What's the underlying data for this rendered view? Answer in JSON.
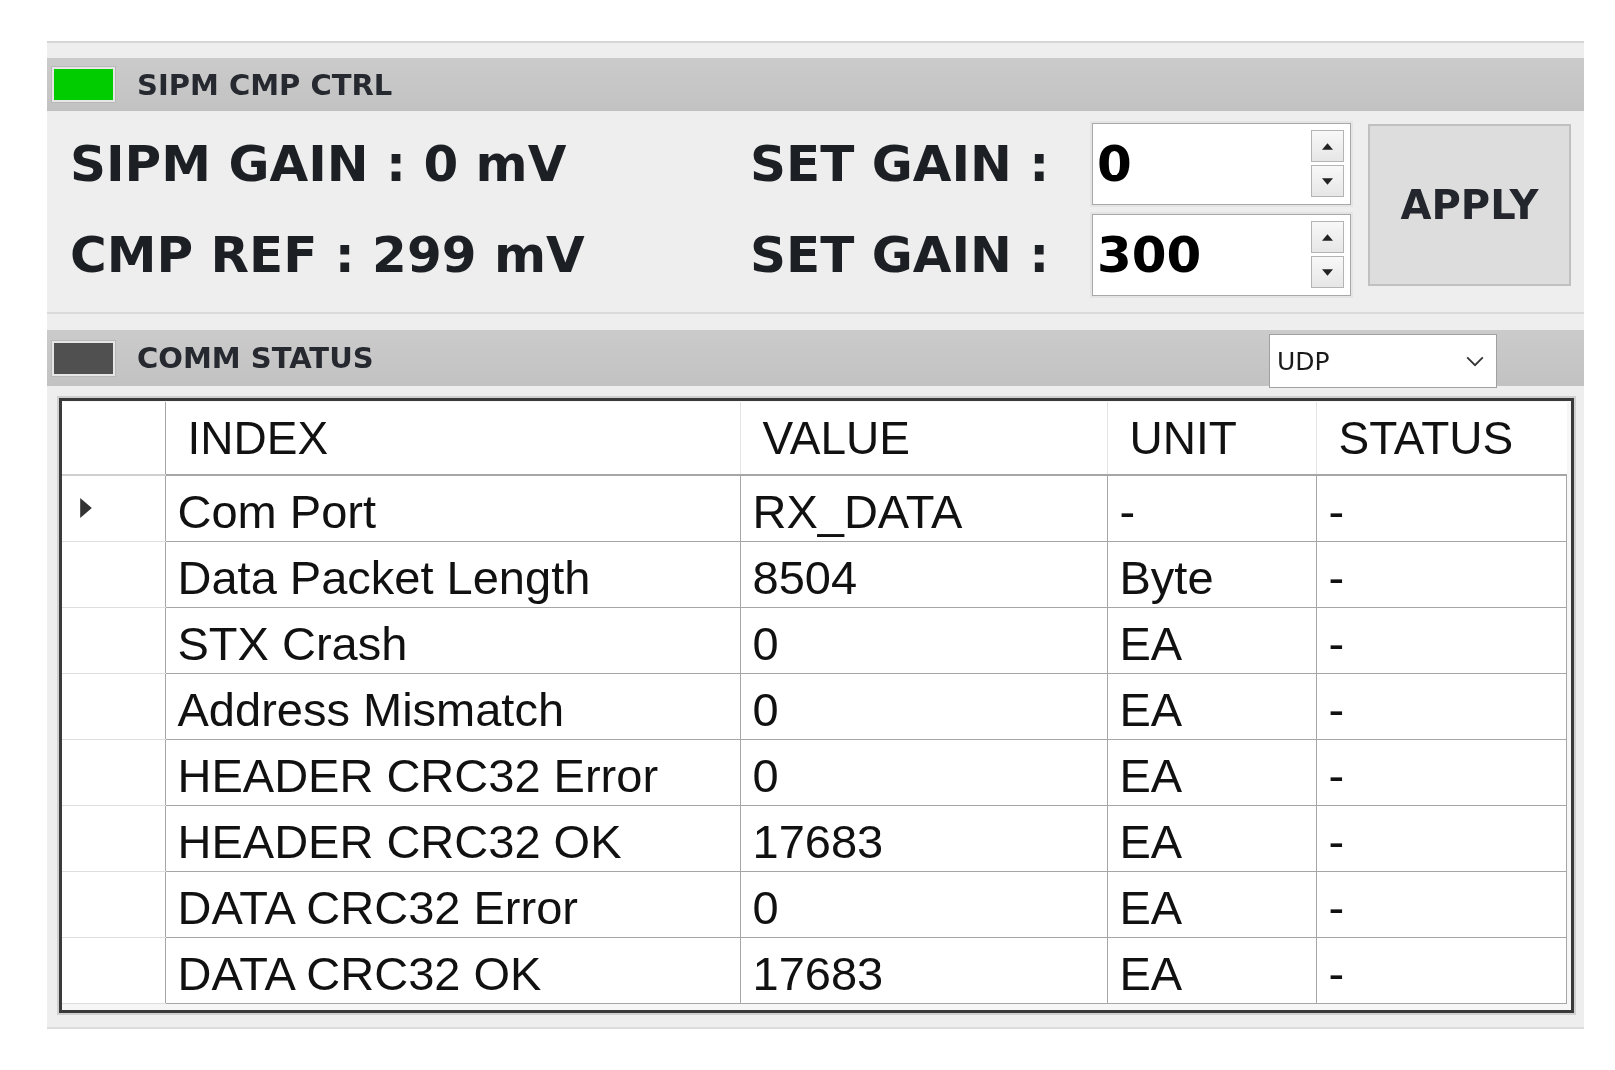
{
  "control_panel": {
    "title": "SIPM CMP CTRL",
    "indicator_on": true,
    "readings": [
      {
        "label": "SIPM GAIN : 0 mV",
        "set_label": "SET GAIN :",
        "set_value": "0"
      },
      {
        "label": "CMP REF : 299 mV",
        "set_label": "SET GAIN :",
        "set_value": "300"
      }
    ],
    "apply_button": "APPLY"
  },
  "comm_panel": {
    "title": "COMM STATUS",
    "indicator_on": false,
    "protocol": {
      "value": "UDP"
    },
    "table": {
      "columns": [
        "INDEX",
        "VALUE",
        "UNIT",
        "STATUS"
      ],
      "rows": [
        {
          "current": true,
          "cells": [
            "Com Port",
            "RX_DATA",
            "-",
            "-"
          ]
        },
        {
          "current": false,
          "cells": [
            "Data Packet Length",
            "8504",
            "Byte",
            "-"
          ]
        },
        {
          "current": false,
          "cells": [
            "STX Crash",
            "0",
            "EA",
            "-"
          ]
        },
        {
          "current": false,
          "cells": [
            "Address Mismatch",
            "0",
            "EA",
            "-"
          ]
        },
        {
          "current": false,
          "cells": [
            "HEADER CRC32 Error",
            "0",
            "EA",
            "-"
          ]
        },
        {
          "current": false,
          "cells": [
            "HEADER CRC32 OK",
            "17683",
            "EA",
            "-"
          ]
        },
        {
          "current": false,
          "cells": [
            "DATA CRC32 Error",
            "0",
            "EA",
            "-"
          ]
        },
        {
          "current": false,
          "cells": [
            "DATA CRC32 OK",
            "17683",
            "EA",
            "-"
          ]
        }
      ]
    }
  }
}
